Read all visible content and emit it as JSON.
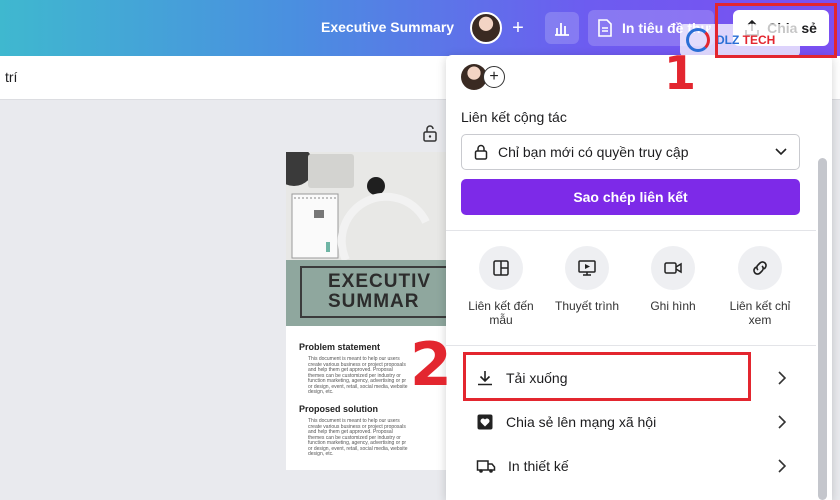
{
  "header": {
    "doc_title": "Executive Summary",
    "print_label": "In tiêu đề thư",
    "share_label": "Chia sẻ"
  },
  "toolbar": {
    "partial_text": "trí"
  },
  "canvas": {
    "band_line_1": "EXECUTIV",
    "band_line_2": "SUMMAR",
    "problem_heading": "Problem statement",
    "problem_text": "This document is meant to help our users create various business or project proposals and help them get approved. Proposal themes can be customized per industry or function marketing, agency, advertising or pr or design, event, retail, social media, website design, etc.",
    "solution_heading": "Proposed solution",
    "solution_text": "This document is meant to help our users create various business or project proposals and help them get approved. Proposal themes can be customized per industry or function marketing, agency, advertising or pr or design, event, retail, social media, website design, etc."
  },
  "share_panel": {
    "collab_label": "Liên kết cộng tác",
    "access_value": "Chỉ bạn mới có quyền truy cập",
    "copy_link_label": "Sao chép liên kết",
    "options": [
      {
        "label": "Liên kết đến mẫu",
        "icon": "template-icon"
      },
      {
        "label": "Thuyết trình",
        "icon": "present-icon"
      },
      {
        "label": "Ghi hình",
        "icon": "video-icon"
      },
      {
        "label": "Liên kết chỉ xem",
        "icon": "link-icon"
      }
    ],
    "rows": [
      {
        "label": "Tải xuống",
        "icon": "download-icon"
      },
      {
        "label": "Chia sẻ lên mạng xã hội",
        "icon": "heart-icon"
      },
      {
        "label": "In thiết kế",
        "icon": "truck-icon"
      }
    ]
  },
  "annotations": {
    "step_1": "1",
    "step_2": "2"
  },
  "watermark": {
    "brand": "DLZ",
    "brand_2": "TECH"
  },
  "colors": {
    "accent_purple": "#7d2ae8",
    "annotation_red": "#e3262f"
  }
}
